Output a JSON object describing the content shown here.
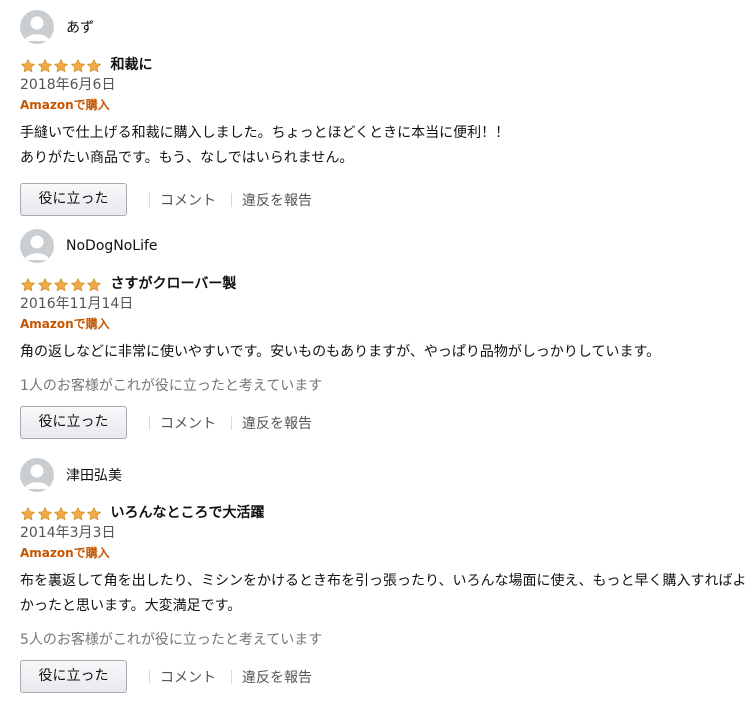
{
  "reviews": [
    {
      "username": "あず",
      "rating": 5,
      "title": "和裁に",
      "date": "2018年6月6日",
      "badge": "Amazonで購入",
      "body": [
        "手縫いで仕上げる和裁に購入しました。ちょっとほどくときに本当に便利！！",
        "ありがたい商品です。もう、なしではいられません。"
      ],
      "helpful_count": "",
      "helpful_label": "役に立った",
      "comment_label": "コメント",
      "report_label": "違反を報告"
    },
    {
      "username": "NoDogNoLife",
      "rating": 5,
      "title": "さすがクローバー製",
      "date": "2016年11月14日",
      "badge": "Amazonで購入",
      "body": [
        "角の返しなどに非常に使いやすいです。安いものもありますが、やっぱり品物がしっかりしています。"
      ],
      "helpful_count": "1人のお客様がこれが役に立ったと考えています",
      "helpful_label": "役に立った",
      "comment_label": "コメント",
      "report_label": "違反を報告"
    },
    {
      "username": "津田弘美",
      "rating": 5,
      "title": "いろんなところで大活躍",
      "date": "2014年3月3日",
      "badge": "Amazonで購入",
      "body": [
        "布を裏返して角を出したり、ミシンをかけるとき布を引っ張ったり、いろんな場面に使え、もっと早く購入すればよ",
        "かったと思います。大変満足です。"
      ],
      "helpful_count": "5人のお客様がこれが役に立ったと考えています",
      "helpful_label": "役に立った",
      "comment_label": "コメント",
      "report_label": "違反を報告"
    }
  ],
  "colors": {
    "star": "#f3a847",
    "star_stroke": "#c98a1a",
    "badge": "#c45500",
    "avatar": "#c9ced3"
  },
  "icons": {
    "avatar": "default-user-icon",
    "star": "star-icon"
  }
}
